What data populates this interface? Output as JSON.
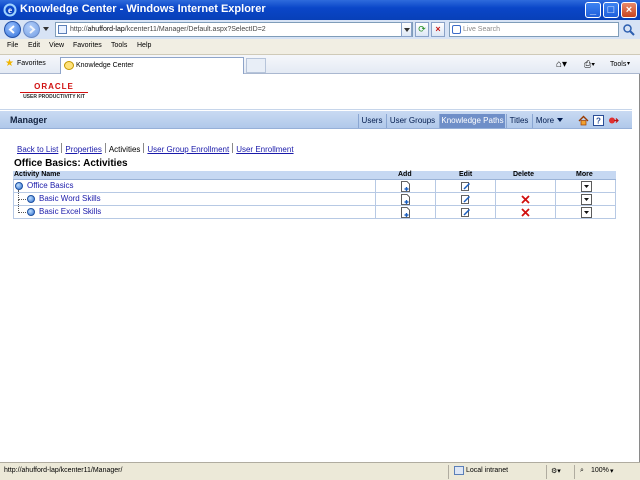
{
  "window": {
    "title": "Knowledge Center - Windows Internet Explorer"
  },
  "addressbar": {
    "url_prefix": "http://",
    "url_host": "ahufford-lap",
    "url_path": "/kcenter11/Manager/Default.aspx?SelectID=2",
    "search_placeholder": "Live Search"
  },
  "menubar": {
    "items": [
      "File",
      "Edit",
      "View",
      "Favorites",
      "Tools",
      "Help"
    ]
  },
  "favoritesbar": {
    "favorites_label": "Favorites",
    "tab_label": "Knowledge Center",
    "tools_label": "Tools"
  },
  "header": {
    "logo_oracle": "ORACLE",
    "logo_product": "USER PRODUCTIVITY KIT"
  },
  "manager_bar": {
    "title": "Manager",
    "nav": [
      "Users",
      "User Groups",
      "Knowledge Paths",
      "Titles",
      "More"
    ],
    "active_nav": "Knowledge Paths"
  },
  "sublinks": [
    "Back to List",
    "Properties",
    "Activities",
    "User Group Enrollment",
    "User Enrollment"
  ],
  "page_title": "Office Basics: Activities",
  "grid": {
    "columns": [
      "Activity Name",
      "Add",
      "Edit",
      "Delete",
      "More"
    ],
    "rows": [
      {
        "name": "Office Basics",
        "level": 0,
        "add": true,
        "edit": true,
        "delete": false,
        "more": true
      },
      {
        "name": "Basic Word Skills",
        "level": 1,
        "add": true,
        "edit": true,
        "delete": true,
        "more": true
      },
      {
        "name": "Basic Excel Skills",
        "level": 1,
        "add": true,
        "edit": true,
        "delete": true,
        "more": true
      }
    ]
  },
  "statusbar": {
    "url": "http://ahufford-lap/kcenter11/Manager/",
    "zone": "Local intranet",
    "zoom": "100%"
  },
  "colors": {
    "title_bar": "#0a46c8",
    "manager_bar": "#b0c8ea",
    "active_nav": "#6f8fc8",
    "link": "#1a1aaa",
    "delete_x": "#d01010",
    "logo_red": "#d01010"
  }
}
